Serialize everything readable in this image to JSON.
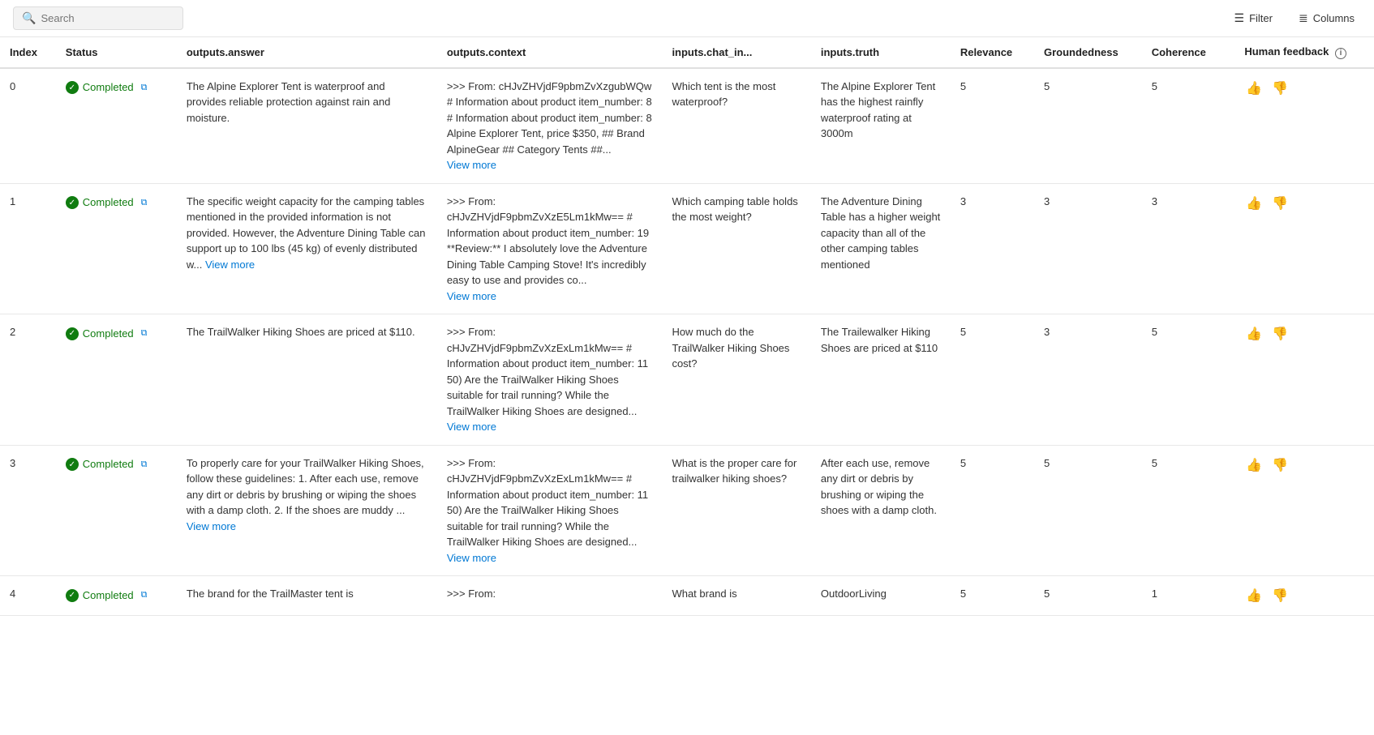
{
  "toolbar": {
    "search_placeholder": "Search",
    "filter_label": "Filter",
    "columns_label": "Columns"
  },
  "table": {
    "columns": [
      {
        "id": "index",
        "label": "Index"
      },
      {
        "id": "status",
        "label": "Status"
      },
      {
        "id": "answer",
        "label": "outputs.answer"
      },
      {
        "id": "context",
        "label": "outputs.context"
      },
      {
        "id": "chat_in",
        "label": "inputs.chat_in..."
      },
      {
        "id": "truth",
        "label": "inputs.truth"
      },
      {
        "id": "relevance",
        "label": "Relevance"
      },
      {
        "id": "groundedness",
        "label": "Groundedness"
      },
      {
        "id": "coherence",
        "label": "Coherence"
      },
      {
        "id": "feedback",
        "label": "Human feedback"
      }
    ],
    "rows": [
      {
        "index": "0",
        "status": "Completed",
        "answer": "The Alpine Explorer Tent is waterproof and provides reliable protection against rain and moisture.",
        "context": ">>> From: cHJvZHVjdF9pbmZvXzgubWQw # Information about product item_number: 8 # Information about product item_number: 8 Alpine Explorer Tent, price $350, ## Brand AlpineGear ## Category Tents ##...",
        "chat_in": "Which tent is the most waterproof?",
        "truth": "The Alpine Explorer Tent has the highest rainfly waterproof rating at 3000m",
        "relevance": "5",
        "groundedness": "5",
        "coherence": "5"
      },
      {
        "index": "1",
        "status": "Completed",
        "answer": "The specific weight capacity for the camping tables mentioned in the provided information is not provided. However, the Adventure Dining Table can support up to 100 lbs (45 kg) of evenly distributed w...",
        "answer_view_more": "View more",
        "context": ">>> From: cHJvZHVjdF9pbmZvXzE5Lm1kMw== # Information about product item_number: 19 **Review:** I absolutely love the Adventure Dining Table Camping Stove! It's incredibly easy to use and provides co...",
        "chat_in": "Which camping table holds the most weight?",
        "truth": "The Adventure Dining Table has a higher weight capacity than all of the other camping tables mentioned",
        "relevance": "3",
        "groundedness": "3",
        "coherence": "3"
      },
      {
        "index": "2",
        "status": "Completed",
        "answer": "The TrailWalker Hiking Shoes are priced at $110.",
        "context": ">>> From: cHJvZHVjdF9pbmZvXzExLm1kMw== # Information about product item_number: 11 50) Are the TrailWalker Hiking Shoes suitable for trail running? While the TrailWalker Hiking Shoes are designed...",
        "chat_in": "How much do the TrailWalker Hiking Shoes cost?",
        "truth": "The Trailewalker Hiking Shoes are priced at $110",
        "relevance": "5",
        "groundedness": "3",
        "coherence": "5"
      },
      {
        "index": "3",
        "status": "Completed",
        "answer": "To properly care for your TrailWalker Hiking Shoes, follow these guidelines: 1. After each use, remove any dirt or debris by brushing or wiping the shoes with a damp cloth. 2. If the shoes are muddy ...",
        "answer_view_more": "View more",
        "context": ">>> From: cHJvZHVjdF9pbmZvXzExLm1kMw== # Information about product item_number: 11 50) Are the TrailWalker Hiking Shoes suitable for trail running? While the TrailWalker Hiking Shoes are designed...",
        "chat_in": "What is the proper care for trailwalker hiking shoes?",
        "truth": "After each use, remove any dirt or debris by brushing or wiping the shoes with a damp cloth.",
        "relevance": "5",
        "groundedness": "5",
        "coherence": "5"
      },
      {
        "index": "4",
        "status": "Completed",
        "answer": "The brand for the TrailMaster tent is",
        "context": ">>> From:",
        "chat_in": "What brand is",
        "truth": "OutdoorLiving",
        "relevance": "5",
        "groundedness": "5",
        "coherence": "1"
      }
    ]
  }
}
